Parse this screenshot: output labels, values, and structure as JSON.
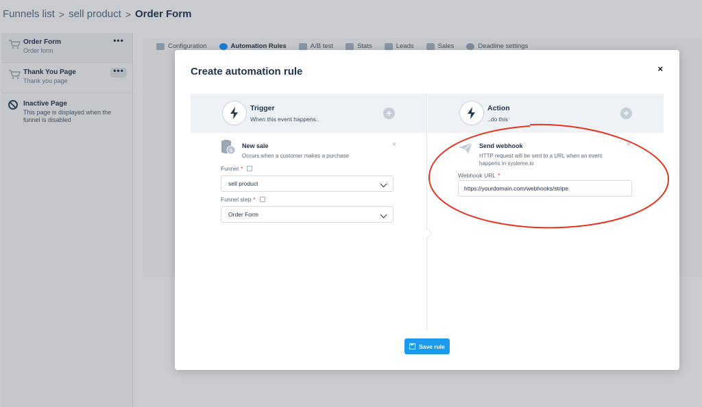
{
  "breadcrumb": {
    "items": [
      "Funnels list",
      "sell product"
    ],
    "current": "Order Form",
    "separator": ">"
  },
  "sidebar": {
    "steps": [
      {
        "title": "Order Form",
        "subtitle": "Order form",
        "menu": "•••"
      },
      {
        "title": "Thank You Page",
        "subtitle": "Thank you page",
        "menu": "•••"
      }
    ],
    "inactive": {
      "title": "Inactive Page",
      "description": "This page is displayed when the funnel is disabled"
    }
  },
  "tabs": [
    {
      "label": "Configuration",
      "icon": "sliders-icon"
    },
    {
      "label": "Automation Rules",
      "icon": "bolt-icon",
      "active": true
    },
    {
      "label": "A/B test",
      "icon": "ab-test-icon"
    },
    {
      "label": "Stats",
      "icon": "chart-icon"
    },
    {
      "label": "Leads",
      "icon": "users-icon"
    },
    {
      "label": "Sales",
      "icon": "dollar-icon"
    },
    {
      "label": "Deadline settings",
      "icon": "clock-icon"
    }
  ],
  "modal": {
    "title": "Create automation rule",
    "close": "×",
    "trigger": {
      "title": "Trigger",
      "subtitle": "When this event happens..",
      "card": {
        "title": "New sale",
        "subtitle": "Occurs when a customer makes a purchase",
        "close": "×",
        "funnel_label": "Funnel",
        "funnel_value": "sell product",
        "step_label": "Funnel step",
        "step_value": "Order Form",
        "required_mark": "*"
      }
    },
    "action": {
      "title": "Action",
      "subtitle": "..do this",
      "card": {
        "title": "Send webhook",
        "subtitle": "HTTP request will be sent to a URL when an event happens in systeme.io",
        "close": "×",
        "url_label": "Webhook URL",
        "url_value": "https://yourdomain.com/webhooks/stripe",
        "required_mark": "*"
      }
    },
    "save_label": "Save rule"
  },
  "colors": {
    "primary": "#1a9bf0",
    "annotation": "#e8321e",
    "required": "#e53935",
    "heading": "#22344d"
  }
}
